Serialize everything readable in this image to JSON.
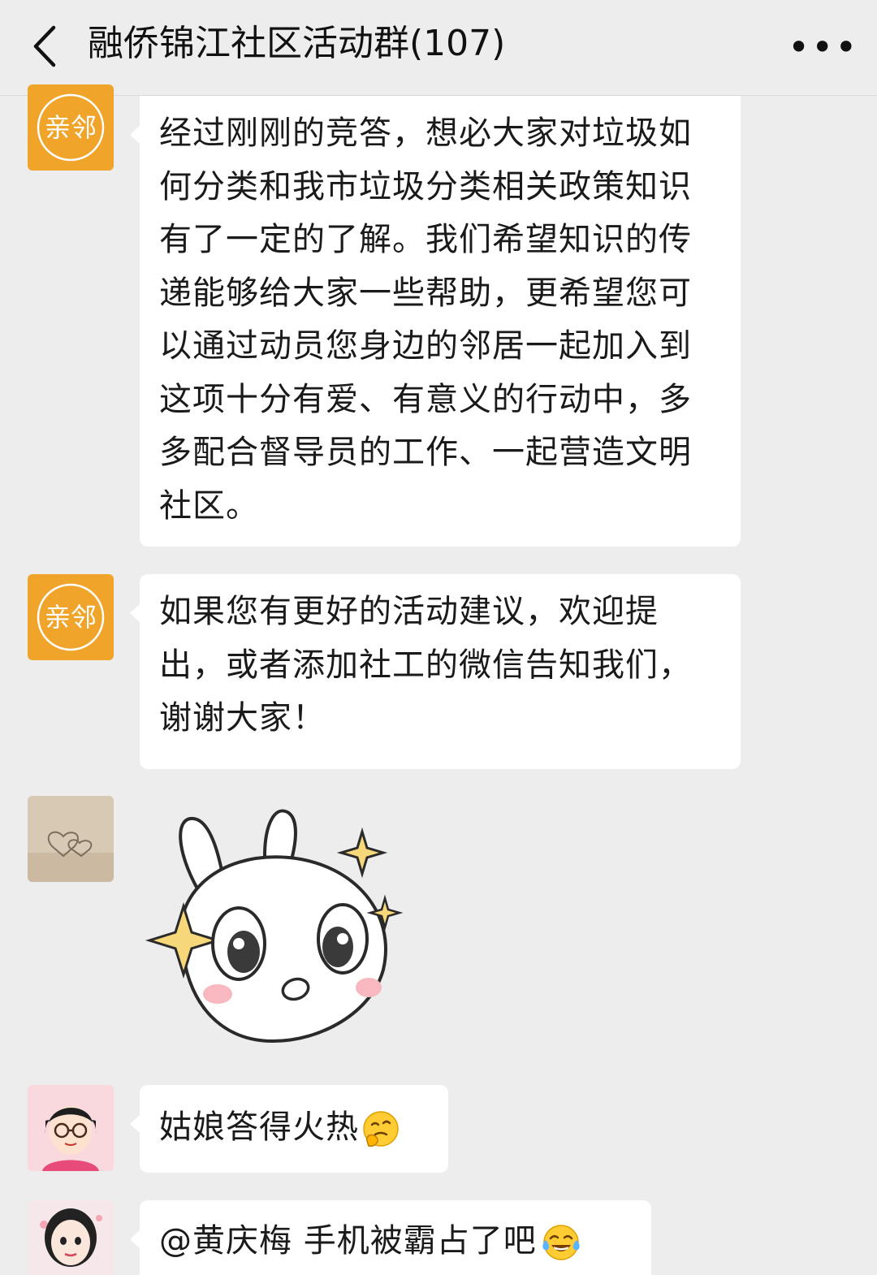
{
  "header": {
    "title": "融侨锦江社区活动群(107)",
    "back_icon": "chevron-left-icon",
    "more_label": "•••"
  },
  "colors": {
    "background": "#ededed",
    "bubble": "#ffffff",
    "org_avatar": "#f0a42a"
  },
  "messages": [
    {
      "avatar": "org-logo-avatar",
      "avatar_text": "亲邻",
      "text": "经过刚刚的竞答，想必大家对垃圾如何分类和我市垃圾分类相关政策知识有了一定的了解。我们希望知识的传递能够给大家一些帮助，更希望您可以通过动员您身边的邻居一起加入到这项十分有爱、有意义的行动中，多多配合督导员的工作、一起营造文明社区。"
    },
    {
      "avatar": "org-logo-avatar",
      "avatar_text": "亲邻",
      "text": "如果您有更好的活动建议，欢迎提出，或者添加社工的微信告知我们，谢谢大家！"
    },
    {
      "avatar": "sand-heart-avatar",
      "sticker": "bunny-sparkle-sticker"
    },
    {
      "avatar": "woman-glasses-avatar",
      "text": "姑娘答得火热",
      "emoji": "thinking-face-emoji"
    },
    {
      "avatar": "woman-cartoon-avatar",
      "text": "@黄庆梅  手机被霸占了吧",
      "emoji": "tears-of-joy-emoji"
    }
  ]
}
